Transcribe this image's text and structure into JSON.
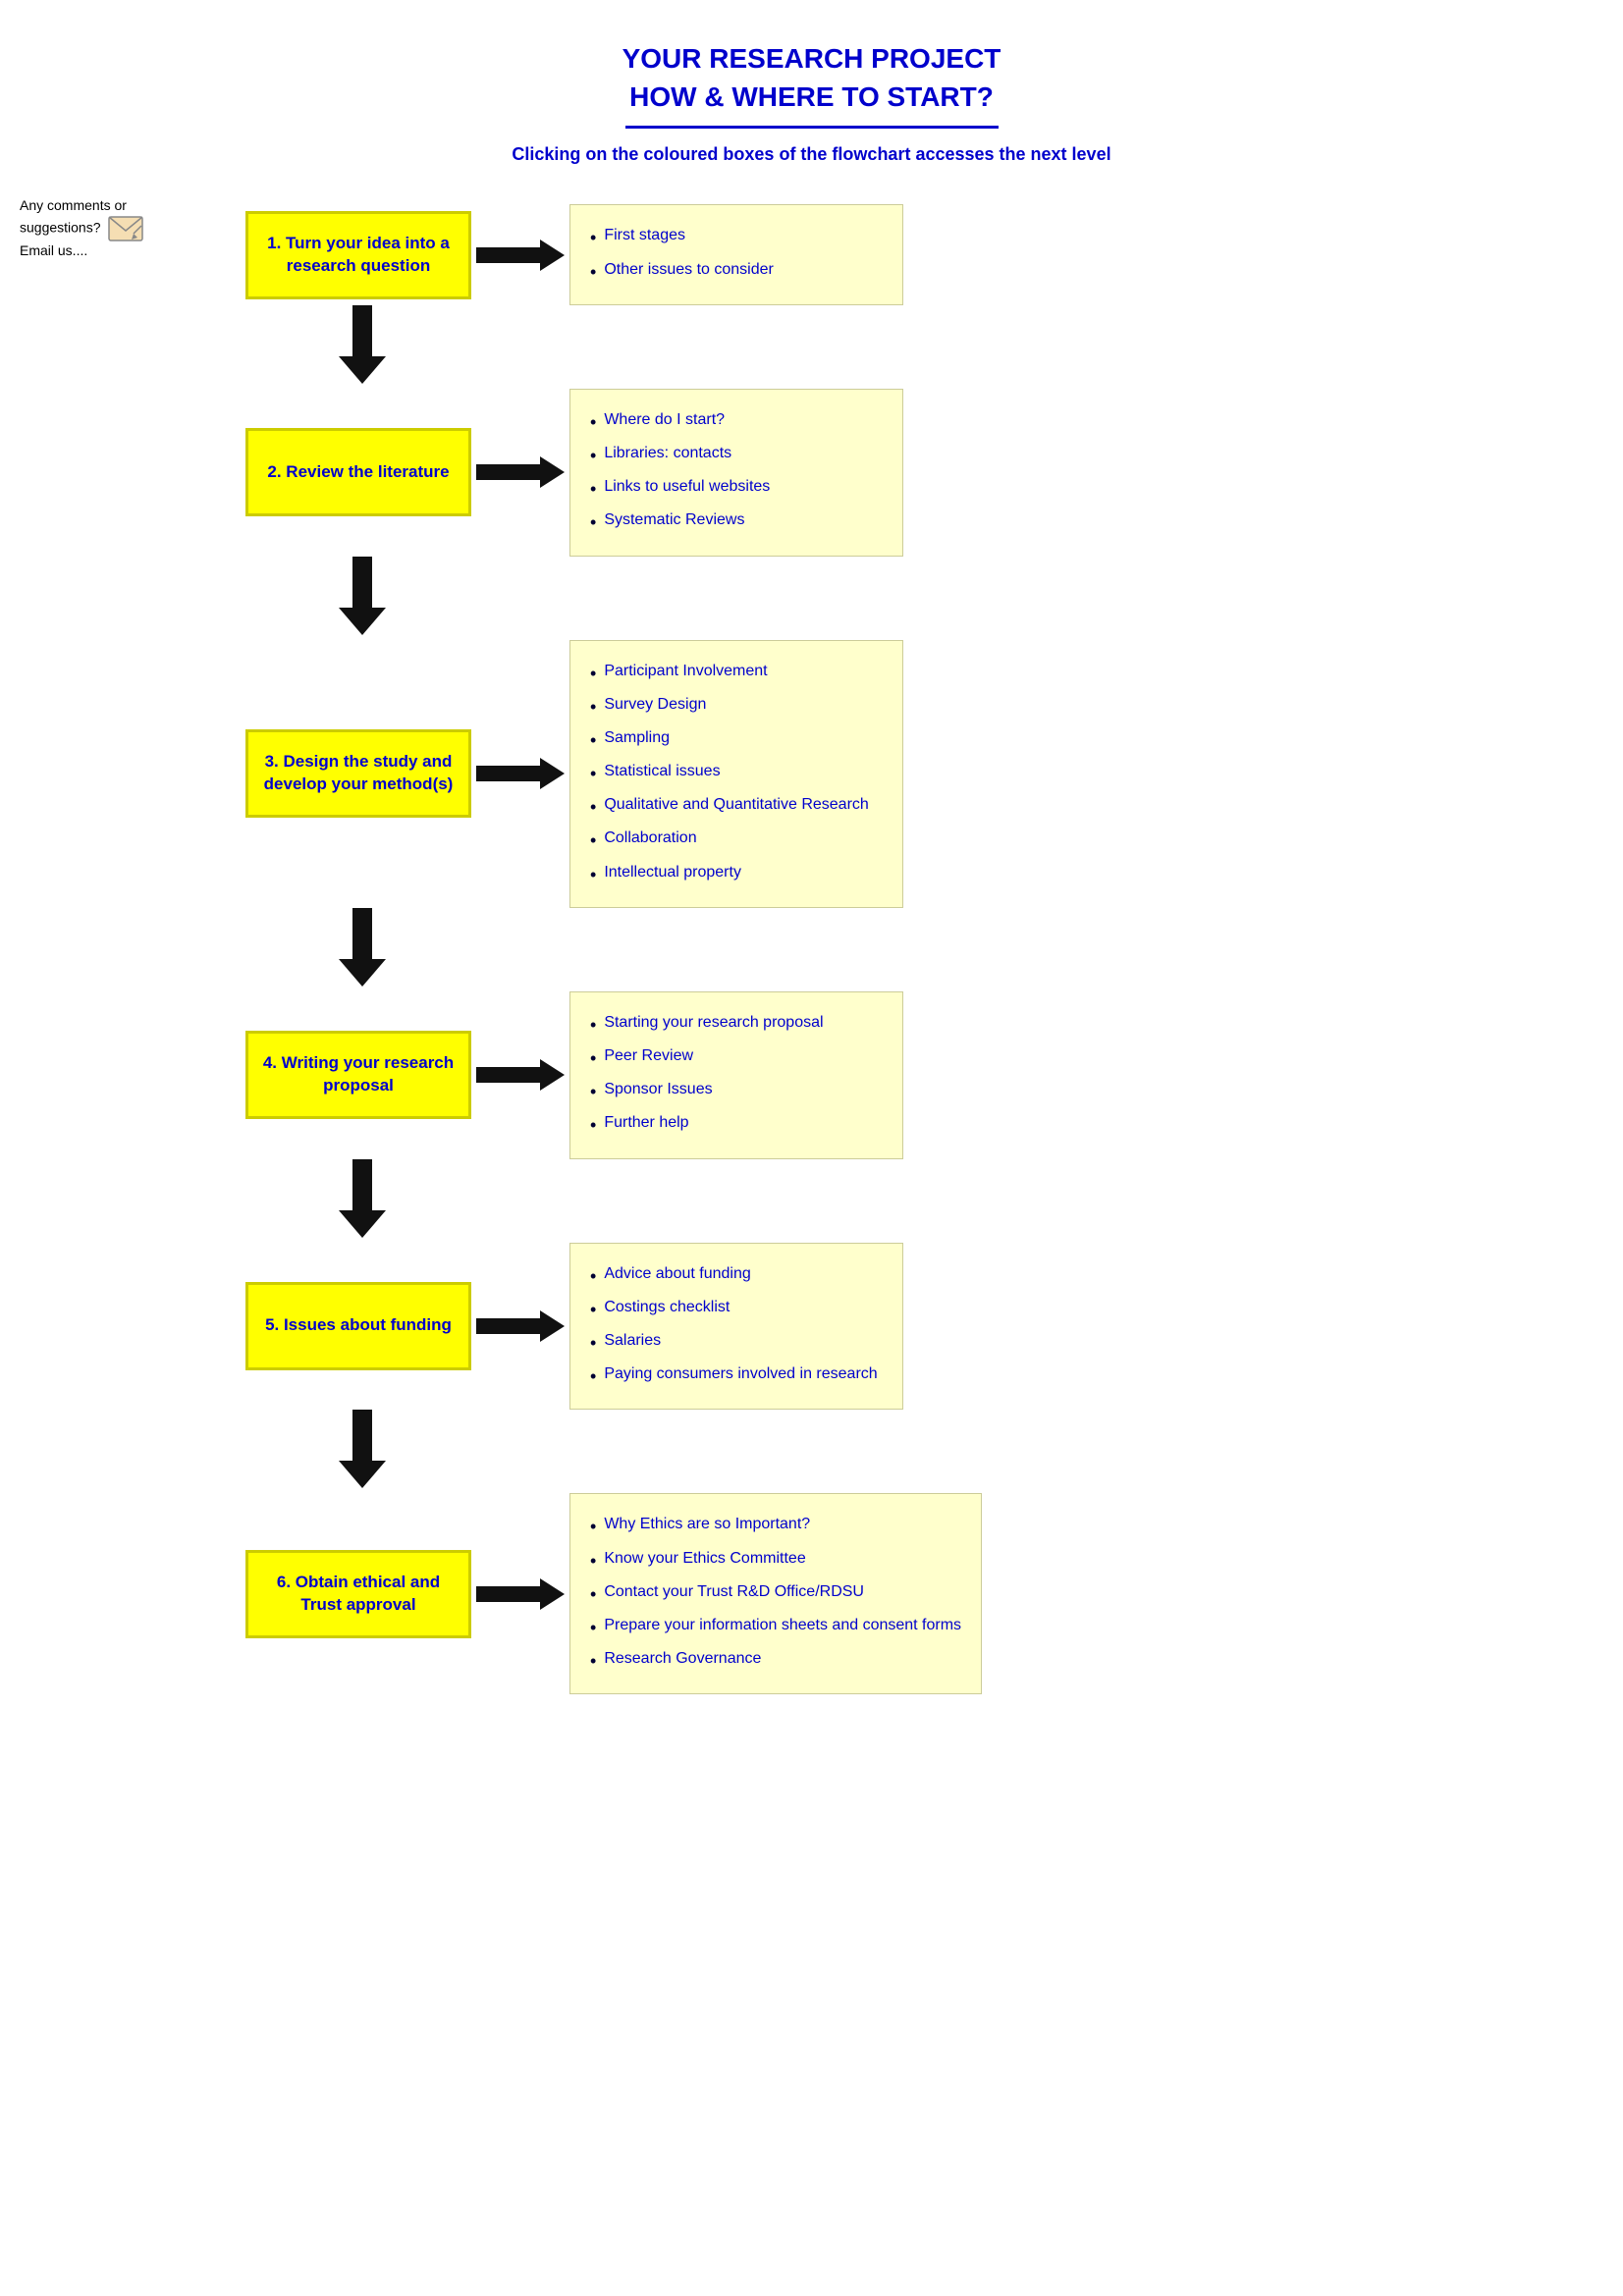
{
  "header": {
    "line1": "YOUR RESEARCH PROJECT",
    "line2": "HOW & WHERE TO START?",
    "subtitle": "Clicking on the coloured boxes of the flowchart accesses the next level"
  },
  "sidebar": {
    "comment_line1": "Any comments or",
    "comment_line2": "suggestions?",
    "comment_line3": "Email us...."
  },
  "steps": [
    {
      "id": "step1",
      "label": "1. Turn your idea into a research question",
      "items": [
        "First stages",
        "Other issues to consider"
      ]
    },
    {
      "id": "step2",
      "label": "2. Review the literature",
      "items": [
        "Where do I start?",
        "Libraries: contacts",
        "Links to useful websites",
        "Systematic Reviews"
      ]
    },
    {
      "id": "step3",
      "label": "3. Design the study and develop your method(s)",
      "items": [
        "Participant Involvement",
        "Survey Design",
        "Sampling",
        "Statistical issues",
        "Qualitative and Quantitative Research",
        "Collaboration",
        "Intellectual property"
      ]
    },
    {
      "id": "step4",
      "label": "4. Writing your research proposal",
      "items": [
        "Starting your research proposal",
        "Peer Review",
        "Sponsor Issues",
        "Further help"
      ]
    },
    {
      "id": "step5",
      "label": "5. Issues about funding",
      "items": [
        "Advice about funding",
        "Costings checklist",
        "Salaries",
        "Paying consumers involved in research"
      ]
    },
    {
      "id": "step6",
      "label": "6. Obtain ethical and Trust approval",
      "items": [
        "Why Ethics are so Important?",
        "Know your Ethics Committee",
        "Contact your Trust R&D Office/RDSU",
        "Prepare your information sheets and consent forms",
        "Research Governance"
      ]
    }
  ]
}
